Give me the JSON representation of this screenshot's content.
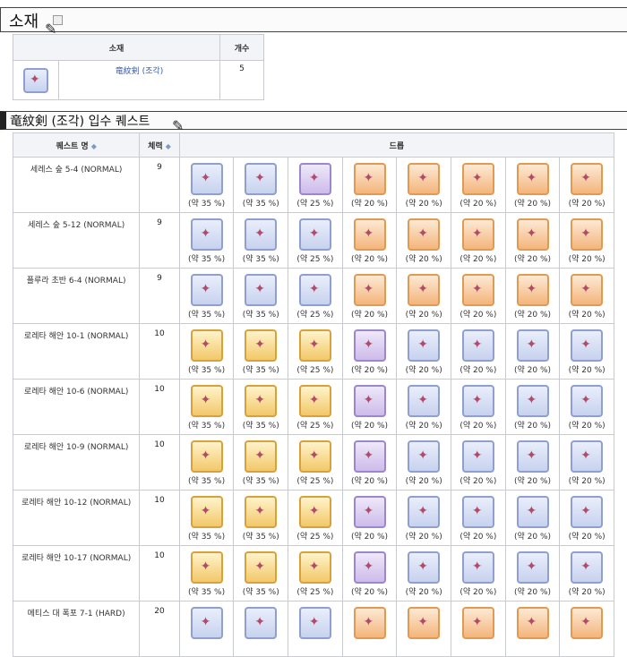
{
  "section1": {
    "title": "소재"
  },
  "material_table": {
    "headers": [
      "소재",
      "개수"
    ],
    "rows": [
      {
        "name": "竜紋剣 (조각)",
        "count": "5"
      }
    ]
  },
  "section2": {
    "title": "竜紋剣 (조각) 입수 퀘스트"
  },
  "quest_table": {
    "headers": {
      "name": "퀘스트 명",
      "stamina": "체력",
      "drop": "드롭"
    },
    "rows": [
      {
        "name": "세레스 숲 5-4 (NORMAL)",
        "stamina": "9",
        "drops": [
          "(약 35 %)",
          "(약 35 %)",
          "(약 25 %)",
          "(약 20 %)",
          "(약 20 %)",
          "(약 20 %)",
          "(약 20 %)",
          "(약 20 %)"
        ]
      },
      {
        "name": "세레스 숲 5-12 (NORMAL)",
        "stamina": "9",
        "drops": [
          "(약 35 %)",
          "(약 35 %)",
          "(약 25 %)",
          "(약 20 %)",
          "(약 20 %)",
          "(약 20 %)",
          "(약 20 %)",
          "(약 20 %)"
        ]
      },
      {
        "name": "플루라 초반 6-4 (NORMAL)",
        "stamina": "9",
        "drops": [
          "(약 35 %)",
          "(약 35 %)",
          "(약 25 %)",
          "(약 20 %)",
          "(약 20 %)",
          "(약 20 %)",
          "(약 20 %)",
          "(약 20 %)"
        ]
      },
      {
        "name": "로레타 해안 10-1 (NORMAL)",
        "stamina": "10",
        "drops": [
          "(약 35 %)",
          "(약 35 %)",
          "(약 25 %)",
          "(약 20 %)",
          "(약 20 %)",
          "(약 20 %)",
          "(약 20 %)",
          "(약 20 %)"
        ]
      },
      {
        "name": "로레타 해안 10-6 (NORMAL)",
        "stamina": "10",
        "drops": [
          "(약 35 %)",
          "(약 35 %)",
          "(약 25 %)",
          "(약 20 %)",
          "(약 20 %)",
          "(약 20 %)",
          "(약 20 %)",
          "(약 20 %)"
        ]
      },
      {
        "name": "로레타 해안 10-9 (NORMAL)",
        "stamina": "10",
        "drops": [
          "(약 35 %)",
          "(약 35 %)",
          "(약 25 %)",
          "(약 20 %)",
          "(약 20 %)",
          "(약 20 %)",
          "(약 20 %)",
          "(약 20 %)"
        ]
      },
      {
        "name": "로레타 해안 10-12 (NORMAL)",
        "stamina": "10",
        "drops": [
          "(약 35 %)",
          "(약 35 %)",
          "(약 25 %)",
          "(약 20 %)",
          "(약 20 %)",
          "(약 20 %)",
          "(약 20 %)",
          "(약 20 %)"
        ]
      },
      {
        "name": "로레타 해안 10-17 (NORMAL)",
        "stamina": "10",
        "drops": [
          "(약 35 %)",
          "(약 35 %)",
          "(약 25 %)",
          "(약 20 %)",
          "(약 20 %)",
          "(약 20 %)",
          "(약 20 %)",
          "(약 20 %)"
        ]
      },
      {
        "name": "메티스 대 폭포 7-1 (HARD)",
        "stamina": "20",
        "drops": [
          "",
          "",
          "",
          "",
          "",
          "",
          "",
          ""
        ]
      }
    ]
  },
  "icon_styles": [
    [
      "blue",
      "blue",
      "purple",
      "orange",
      "orange",
      "orange",
      "orange",
      "orange"
    ],
    [
      "blue",
      "blue",
      "blue",
      "orange",
      "orange",
      "orange",
      "orange",
      "orange"
    ],
    [
      "blue",
      "blue",
      "blue",
      "orange",
      "orange",
      "orange",
      "orange",
      "orange"
    ],
    [
      "gold",
      "gold",
      "gold",
      "purple",
      "blue",
      "blue",
      "blue",
      "blue"
    ],
    [
      "gold",
      "gold",
      "gold",
      "purple",
      "blue",
      "blue",
      "blue",
      "blue"
    ],
    [
      "gold",
      "gold",
      "gold",
      "purple",
      "blue",
      "blue",
      "blue",
      "blue"
    ],
    [
      "gold",
      "gold",
      "gold",
      "purple",
      "blue",
      "blue",
      "blue",
      "blue"
    ],
    [
      "gold",
      "gold",
      "gold",
      "purple",
      "blue",
      "blue",
      "blue",
      "blue"
    ],
    [
      "blue",
      "blue",
      "blue",
      "orange",
      "orange",
      "orange",
      "orange",
      "orange"
    ]
  ],
  "icons": [
    "sword-fragment-icon",
    "item-icon"
  ]
}
